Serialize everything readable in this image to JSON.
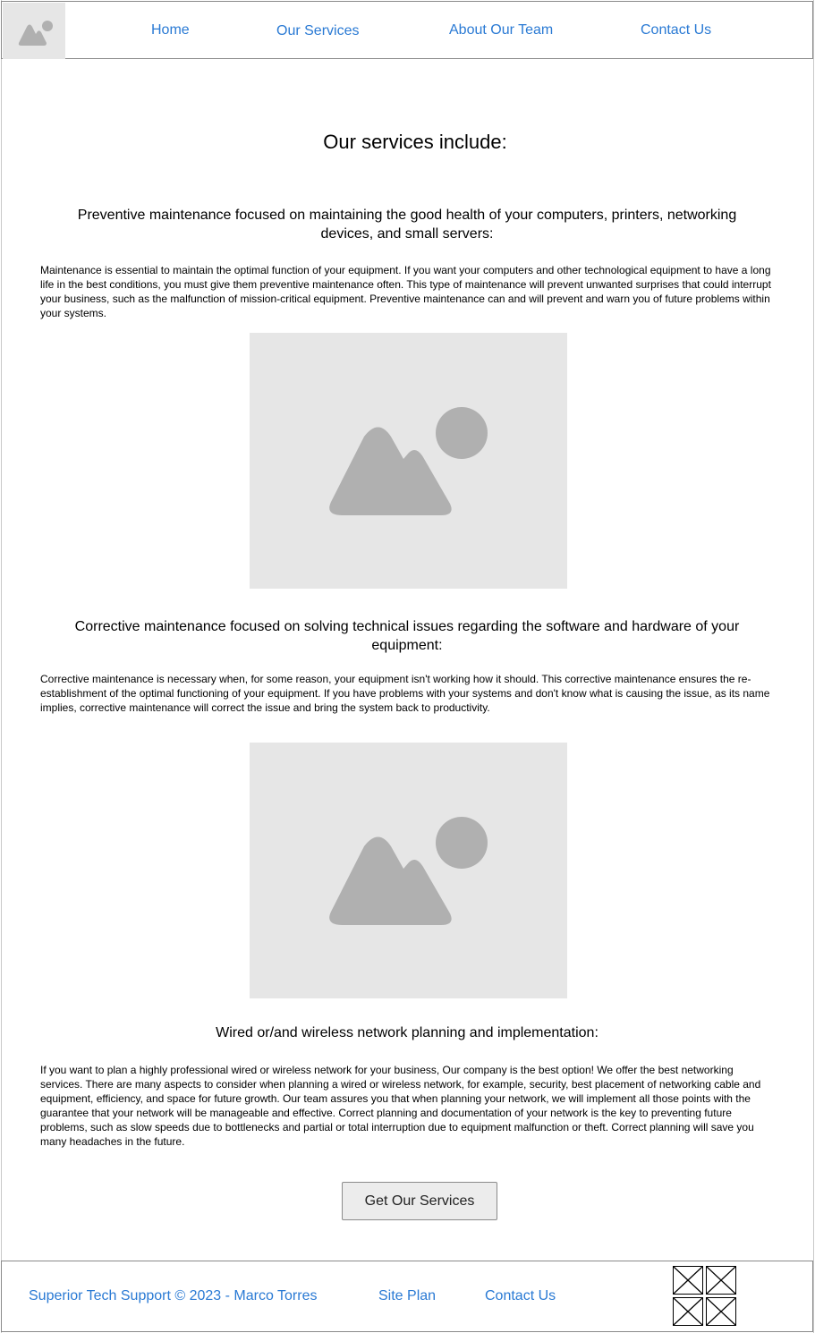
{
  "nav": {
    "items": [
      {
        "label": "Home"
      },
      {
        "label": "Our Services"
      },
      {
        "label": "About Our Team"
      },
      {
        "label": "Contact Us"
      }
    ]
  },
  "main": {
    "title": "Our services include:",
    "sections": [
      {
        "heading": "Preventive maintenance focused on maintaining the good health of your computers, printers, networking devices, and small servers:",
        "body": "Maintenance is essential to maintain the optimal function of your equipment. If you want your computers and other technological equipment to have a long life in the best conditions, you must give them preventive maintenance often. This type of maintenance will prevent unwanted surprises that could interrupt your business, such as the malfunction of mission-critical equipment. Preventive maintenance can and will prevent and warn you of future problems within your systems."
      },
      {
        "heading": "Corrective maintenance focused on solving technical issues regarding the software and hardware of your equipment:",
        "body": "Corrective maintenance is necessary when, for some reason, your equipment isn't working how it should. This corrective maintenance ensures the re-establishment of the optimal functioning of your equipment. If you have problems with your systems and don't know what is causing the issue, as its name implies, corrective maintenance will correct the issue and bring the system back to productivity."
      },
      {
        "heading": "Wired or/and wireless network planning and implementation:",
        "body": "If you want to plan a highly professional wired or wireless network for your business, Our company is the best option! We offer the best networking services. There are many aspects to consider when planning a wired or wireless network, for example, security, best placement of networking cable and equipment, efficiency, and space for future growth. Our team assures you that when planning your network, we will implement all those points with the guarantee that your network will be manageable and effective. Correct planning and documentation of your network is the key to preventing future problems, such as slow speeds due to bottlenecks and partial or total interruption due to equipment malfunction or theft. Correct planning will save you many headaches in the future."
      }
    ],
    "cta_label": "Get Our Services"
  },
  "footer": {
    "copyright": "Superior Tech Support © 2023 - Marco Torres",
    "site_plan": "Site Plan",
    "contact": "Contact Us"
  },
  "icons": {
    "logo": "image-placeholder-icon",
    "image": "image-placeholder-icon",
    "social": "social-placeholder-icon"
  },
  "colors": {
    "link": "#2a7ad4",
    "placeholder_bg": "#e6e6e6",
    "placeholder_fg": "#b0b0b0"
  }
}
